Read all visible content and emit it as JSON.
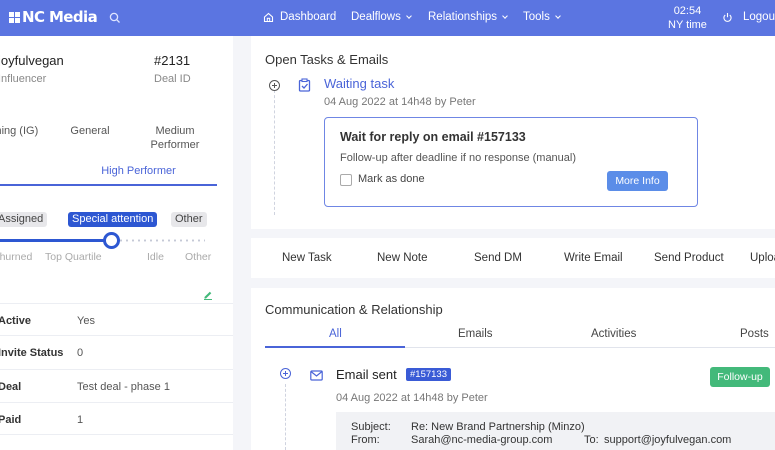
{
  "nav": {
    "brand": "NC Media",
    "items": [
      {
        "label": "Dashboard",
        "icon": "home-icon"
      },
      {
        "label": "Dealflows",
        "icon": "chevron-down-icon"
      },
      {
        "label": "Relationships",
        "icon": "chevron-down-icon"
      },
      {
        "label": "Tools",
        "icon": "chevron-down-icon"
      }
    ],
    "time": "02:54",
    "timezone": "NY time",
    "logout": "Logout"
  },
  "profile": {
    "name": "joyfulvegan",
    "role": "Influencer",
    "deal_id": "#2131",
    "deal_id_label": "Deal ID",
    "attributes": [
      "Gaming (IG)",
      "General",
      "Medium Performer"
    ],
    "tab": "High Performer",
    "status_pills": [
      {
        "label": "Assigned",
        "active": false
      },
      {
        "label": "Special attention",
        "active": true
      },
      {
        "label": "Other",
        "active": false
      }
    ],
    "scale_labels": [
      "Churned",
      "Top Quartile",
      "Idle",
      "Other"
    ],
    "slider_level": 0.55,
    "rows": [
      {
        "key": "Active",
        "value": "Yes"
      },
      {
        "key": "Invite Status",
        "value": "0"
      },
      {
        "key": "Deal",
        "value": "Test deal - phase 1"
      },
      {
        "key": "Paid",
        "value": "1"
      }
    ]
  },
  "tasks": {
    "title": "Open Tasks & Emails",
    "task_title": "Waiting task",
    "task_meta": "04 Aug 2022 at 14h48 by Peter",
    "box_title": "Wait for reply on email #157133",
    "box_sub": "Follow-up after deadline if no response (manual)",
    "mark_done": "Mark as done",
    "more_info": "More Info"
  },
  "actions": [
    "New Task",
    "New Note",
    "Send DM",
    "Write Email",
    "Send Product",
    "Upload"
  ],
  "comm": {
    "title": "Communication & Relationship",
    "tabs": [
      "All",
      "Emails",
      "Activities",
      "Posts"
    ],
    "active_tab": "All",
    "email_title": "Email sent",
    "email_badge": "#157133",
    "email_meta": "04 Aug 2022 at 14h48 by Peter",
    "follow_up": "Follow-up",
    "subject_label": "Subject:",
    "subject": "Re: New Brand Partnership (Minzo)",
    "from_label": "From:",
    "from": "Sarah@nc-media-group.com",
    "to_label": "To:",
    "to": "support@joyfulvegan.com"
  },
  "colors": {
    "nav": "#5b75e1",
    "accent": "#4a64d8",
    "success": "#43b97a"
  }
}
